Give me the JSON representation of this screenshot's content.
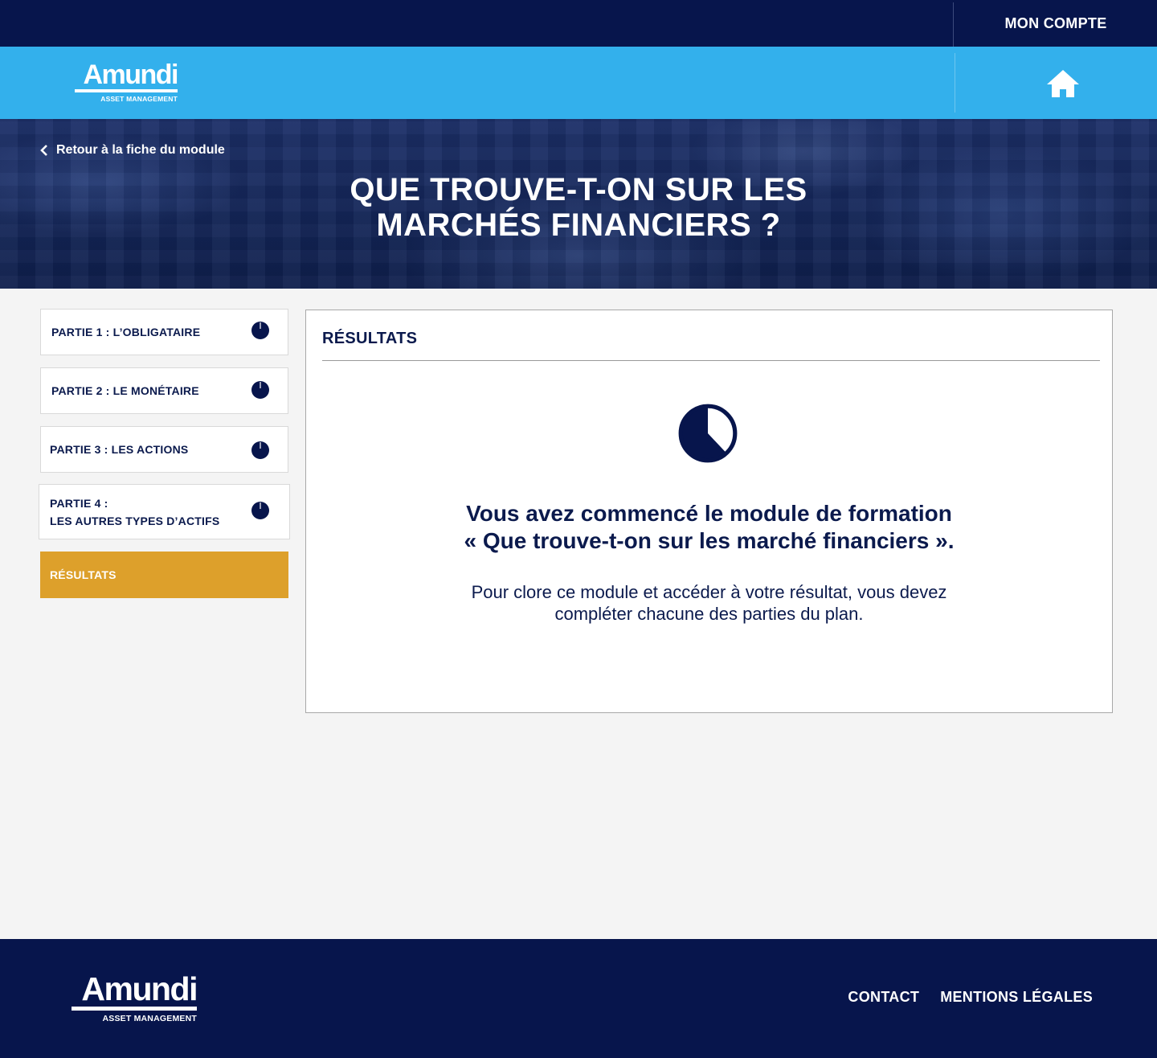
{
  "header": {
    "account_label": "MON COMPTE"
  },
  "brand": {
    "name": "Amundi",
    "tagline": "ASSET MANAGEMENT"
  },
  "hero": {
    "back_label": "Retour à la fiche du module",
    "title_line1": "QUE TROUVE-T-ON SUR LES",
    "title_line2": "MARCHÉS FINANCIERS ?"
  },
  "sidebar": {
    "items": [
      {
        "label_line1": "PARTIE 1 : L’OBLIGATAIRE",
        "label_line2": "",
        "progress": 0.0
      },
      {
        "label_line1": "PARTIE 2 : LE MONÉTAIRE",
        "label_line2": "",
        "progress": 0.0
      },
      {
        "label_line1": "PARTIE 3 : LES ACTIONS",
        "label_line2": "",
        "progress": 0.0
      },
      {
        "label_line1": "PARTIE 4 :",
        "label_line2": "LES AUTRES TYPES D’ACTIFS",
        "progress": 0.0
      },
      {
        "label_line1": "RÉSULTATS",
        "label_line2": "",
        "active": true
      }
    ]
  },
  "results": {
    "title": "RÉSULTATS",
    "overall_progress": 0.38,
    "message_line1": "Vous avez commencé le module de formation",
    "message_line2": "« Que trouve-t-on sur les marché financiers ».",
    "body_line1": "Pour clore ce module et accéder à votre résultat, vous devez",
    "body_line2": "compléter chacune des parties du plan."
  },
  "footer": {
    "links": [
      "CONTACT",
      "MENTIONS LÉGALES"
    ]
  },
  "colors": {
    "navy": "#07154c",
    "sky": "#33b0ec",
    "accent": "#dda02b",
    "text": "#0b1a4d"
  },
  "icons": {
    "home": "home-icon",
    "back": "chevron-left-icon",
    "progress": "pie-progress-icon"
  }
}
